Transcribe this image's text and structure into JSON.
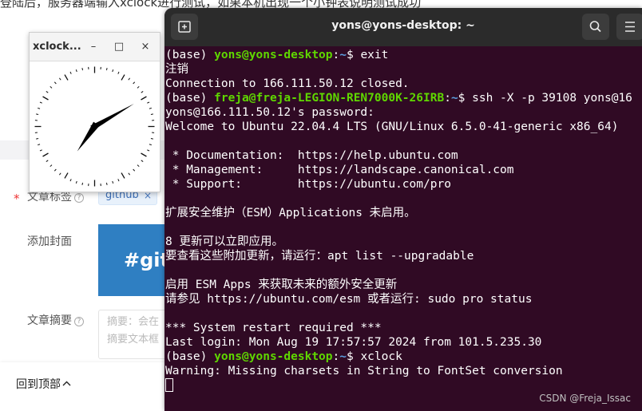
{
  "background": {
    "top_text": "登陆后，服务器端输入xclock进行测试，如果本机出现一个小钟表说明测试成功",
    "rows": {
      "tags_label": "文章标签",
      "cover_label": "添加封面",
      "summary_label": "文章摘要"
    },
    "required_mark": "*",
    "tag": {
      "text": "github",
      "remove": "×"
    },
    "cover_text": "#git",
    "summary_placeholder_1": "摘要：会在",
    "summary_placeholder_2": "摘要文本框",
    "back_to_top": "回到顶部",
    "watermark": "CSDN @Freja_Issac"
  },
  "xclock": {
    "title": "xclock...",
    "minimize": "–",
    "maximize": "□",
    "close": "×",
    "time": {
      "hour": 7,
      "minute": 10
    }
  },
  "terminal": {
    "title": "yons@yons-desktop: ~",
    "lines": [
      [
        {
          "t": "(base) "
        },
        {
          "t": "yons@yons-desktop",
          "c": "green"
        },
        {
          "t": ":"
        },
        {
          "t": "~",
          "c": "blue"
        },
        {
          "t": "$ exit"
        }
      ],
      [
        {
          "t": "注销"
        }
      ],
      [
        {
          "t": "Connection to 166.111.50.12 closed."
        }
      ],
      [
        {
          "t": "(base) "
        },
        {
          "t": "freja@freja-LEGION-REN7000K-26IRB",
          "c": "green"
        },
        {
          "t": ":"
        },
        {
          "t": "~",
          "c": "blue"
        },
        {
          "t": "$ ssh -X -p 39108 yons@16"
        }
      ],
      [
        {
          "t": "yons@166.111.50.12's password:"
        }
      ],
      [
        {
          "t": "Welcome to Ubuntu 22.04.4 LTS (GNU/Linux 6.5.0-41-generic x86_64)"
        }
      ],
      [
        {
          "t": ""
        }
      ],
      [
        {
          "t": " * Documentation:  https://help.ubuntu.com"
        }
      ],
      [
        {
          "t": " * Management:     https://landscape.canonical.com"
        }
      ],
      [
        {
          "t": " * Support:        https://ubuntu.com/pro"
        }
      ],
      [
        {
          "t": ""
        }
      ],
      [
        {
          "t": "扩展安全维护（ESM）Applications 未启用。"
        }
      ],
      [
        {
          "t": ""
        }
      ],
      [
        {
          "t": "8 更新可以立即应用。"
        }
      ],
      [
        {
          "t": "要查看这些附加更新，请运行：apt list --upgradable"
        }
      ],
      [
        {
          "t": ""
        }
      ],
      [
        {
          "t": "启用 ESM Apps 来获取未来的额外安全更新"
        }
      ],
      [
        {
          "t": "请参见 https://ubuntu.com/esm 或者运行: sudo pro status"
        }
      ],
      [
        {
          "t": ""
        }
      ],
      [
        {
          "t": "*** System restart required ***"
        }
      ],
      [
        {
          "t": "Last login: Mon Aug 19 17:57:57 2024 from 101.5.235.30"
        }
      ],
      [
        {
          "t": "(base) "
        },
        {
          "t": "yons@yons-desktop",
          "c": "green"
        },
        {
          "t": ":"
        },
        {
          "t": "~",
          "c": "blue"
        },
        {
          "t": "$ xclock"
        }
      ],
      [
        {
          "t": "Warning: Missing charsets in String to FontSet conversion"
        }
      ]
    ]
  },
  "colors": {
    "terminal_bg": "#300a24",
    "prompt_user": "#5fd700",
    "prompt_path": "#5c9fe0"
  },
  "icons": [
    "new-tab-icon",
    "search-icon",
    "hamburger-menu-icon",
    "help-circle-icon",
    "chevron-up-icon"
  ]
}
